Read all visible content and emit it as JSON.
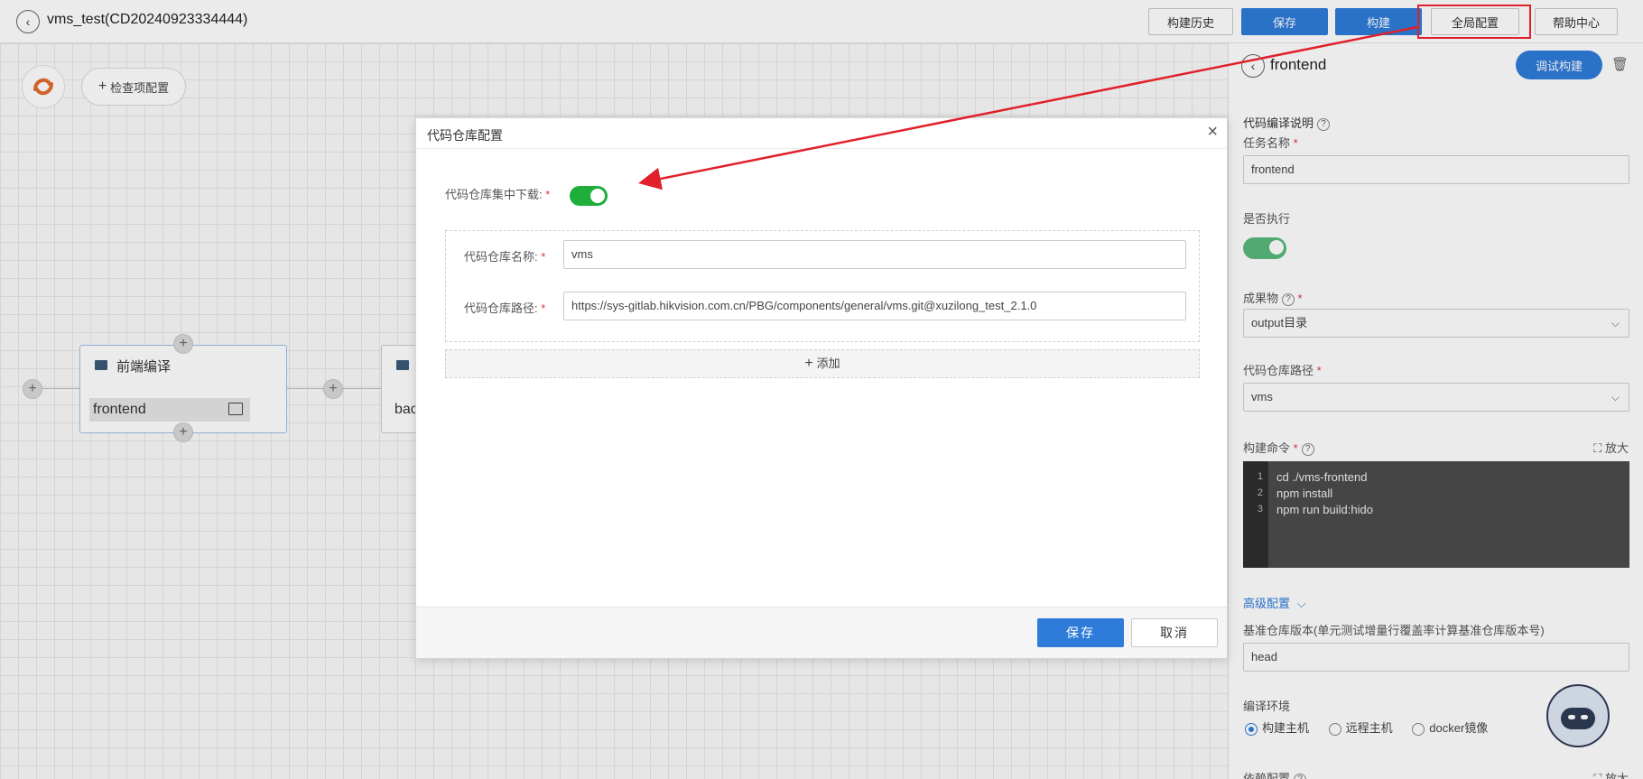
{
  "topbar": {
    "title": "vms_test(CD20240923334444)",
    "buttons": {
      "history": "构建历史",
      "save": "保存",
      "build": "构建",
      "global_config": "全局配置",
      "help": "帮助中心"
    }
  },
  "canvas": {
    "check_config_label": "检查项配置",
    "nodes": [
      {
        "title": "前端编译",
        "task": "frontend"
      },
      {
        "title": "",
        "task": "bac"
      }
    ]
  },
  "panel": {
    "node_name": "frontend",
    "debug_build_label": "调试构建",
    "section_title": "代码编译说明",
    "task_name_label": "任务名称",
    "task_name_value": "frontend",
    "execute_label": "是否执行",
    "execute_on": true,
    "artifact_label": "成果物",
    "artifact_value": "output目录",
    "repo_path_label": "代码仓库路径",
    "repo_path_value": "vms",
    "build_cmd_label": "构建命令",
    "expand_label": "放大",
    "code_lines": [
      "cd ./vms-frontend",
      "npm install",
      "npm run build:hido"
    ],
    "advanced_label": "高级配置",
    "baseline_label": "基准仓库版本(单元测试增量行覆盖率计算基准仓库版本号)",
    "baseline_value": "head",
    "env_label": "编译环境",
    "env_options": [
      "构建主机",
      "远程主机",
      "docker镜像"
    ],
    "env_selected": "构建主机",
    "dep_label": "依赖配置",
    "dep_expand_label": "放大"
  },
  "modal": {
    "title": "代码仓库配置",
    "centralized_label": "代码仓库集中下载:",
    "centralized_on": true,
    "repo_name_label": "代码仓库名称:",
    "repo_name_value": "vms",
    "repo_path_label": "代码仓库路径:",
    "repo_path_value": "https://sys-gitlab.hikvision.com.cn/PBG/components/general/vms.git@xuzilong_test_2.1.0",
    "add_label": "添加",
    "save_label": "保存",
    "cancel_label": "取消"
  },
  "colors": {
    "primary": "#2e7bd9",
    "toggle_on": "#1fae3a",
    "annotation": "#e0202a",
    "required": "#e0393e"
  }
}
